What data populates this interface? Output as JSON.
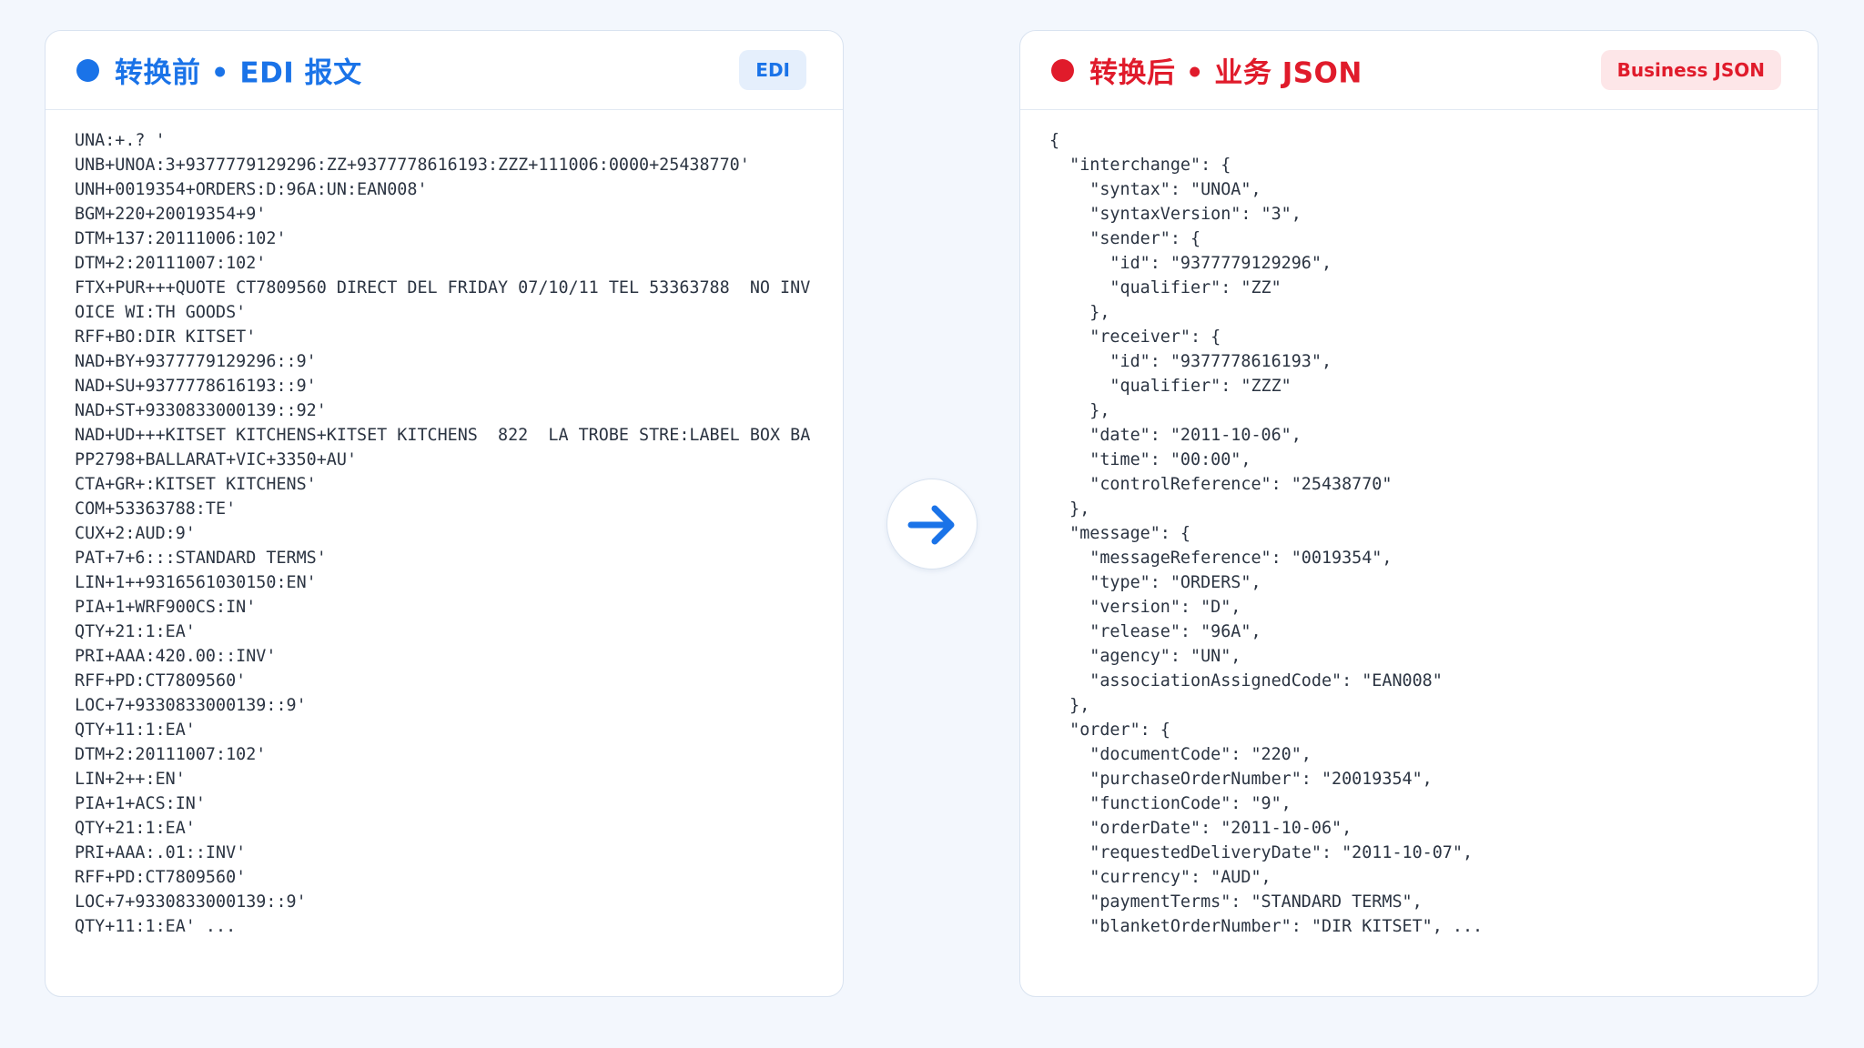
{
  "colors": {
    "edi_accent": "#1a73e8",
    "edi_badge_bg": "#e5effc",
    "json_accent": "#e01b2b",
    "json_badge_bg": "#fde6e8",
    "arrow": "#1a73e8"
  },
  "edi_panel": {
    "title": "转换前 • EDI 报文",
    "badge": "EDI",
    "lines": [
      "UNA:+.? '",
      "UNB+UNOA:3+9377779129296:ZZ+9377778616193:ZZZ+111006:0000+25438770'",
      "UNH+0019354+ORDERS:D:96A:UN:EAN008'",
      "BGM+220+20019354+9'",
      "DTM+137:20111006:102'",
      "DTM+2:20111007:102'",
      "FTX+PUR+++QUOTE CT7809560 DIRECT DEL FRIDAY 07/10/11 TEL 53363788  NO INV",
      "OICE WI:TH GOODS'",
      "RFF+BO:DIR KITSET'",
      "NAD+BY+9377779129296::9'",
      "NAD+SU+9377778616193::9'",
      "NAD+ST+9330833000139::92'",
      "NAD+UD+++KITSET KITCHENS+KITSET KITCHENS  822  LA TROBE STRE:LABEL BOX BA",
      "PP2798+BALLARAT+VIC+3350+AU'",
      "CTA+GR+:KITSET KITCHENS'",
      "COM+53363788:TE'",
      "CUX+2:AUD:9'",
      "PAT+7+6:::STANDARD TERMS'",
      "LIN+1++9316561030150:EN'",
      "PIA+1+WRF900CS:IN'",
      "QTY+21:1:EA'",
      "PRI+AAA:420.00::INV'",
      "RFF+PD:CT7809560'",
      "LOC+7+9330833000139::9'",
      "QTY+11:1:EA'",
      "DTM+2:20111007:102'",
      "LIN+2++:EN'",
      "PIA+1+ACS:IN'",
      "QTY+21:1:EA'",
      "PRI+AAA:.01::INV'",
      "RFF+PD:CT7809560'",
      "LOC+7+9330833000139::9'",
      "QTY+11:1:EA' ..."
    ]
  },
  "json_panel": {
    "title": "转换后 • 业务 JSON",
    "badge": "Business JSON",
    "lines": [
      "{",
      "  \"interchange\": {",
      "    \"syntax\": \"UNOA\",",
      "    \"syntaxVersion\": \"3\",",
      "    \"sender\": {",
      "      \"id\": \"9377779129296\",",
      "      \"qualifier\": \"ZZ\"",
      "    },",
      "    \"receiver\": {",
      "      \"id\": \"9377778616193\",",
      "      \"qualifier\": \"ZZZ\"",
      "    },",
      "    \"date\": \"2011-10-06\",",
      "    \"time\": \"00:00\",",
      "    \"controlReference\": \"25438770\"",
      "  },",
      "  \"message\": {",
      "    \"messageReference\": \"0019354\",",
      "    \"type\": \"ORDERS\",",
      "    \"version\": \"D\",",
      "    \"release\": \"96A\",",
      "    \"agency\": \"UN\",",
      "    \"associationAssignedCode\": \"EAN008\"",
      "  },",
      "  \"order\": {",
      "    \"documentCode\": \"220\",",
      "    \"purchaseOrderNumber\": \"20019354\",",
      "    \"functionCode\": \"9\",",
      "    \"orderDate\": \"2011-10-06\",",
      "    \"requestedDeliveryDate\": \"2011-10-07\",",
      "    \"currency\": \"AUD\",",
      "    \"paymentTerms\": \"STANDARD TERMS\",",
      "    \"blanketOrderNumber\": \"DIR KITSET\", ..."
    ]
  },
  "arrow": {
    "icon": "arrow-right-icon"
  }
}
